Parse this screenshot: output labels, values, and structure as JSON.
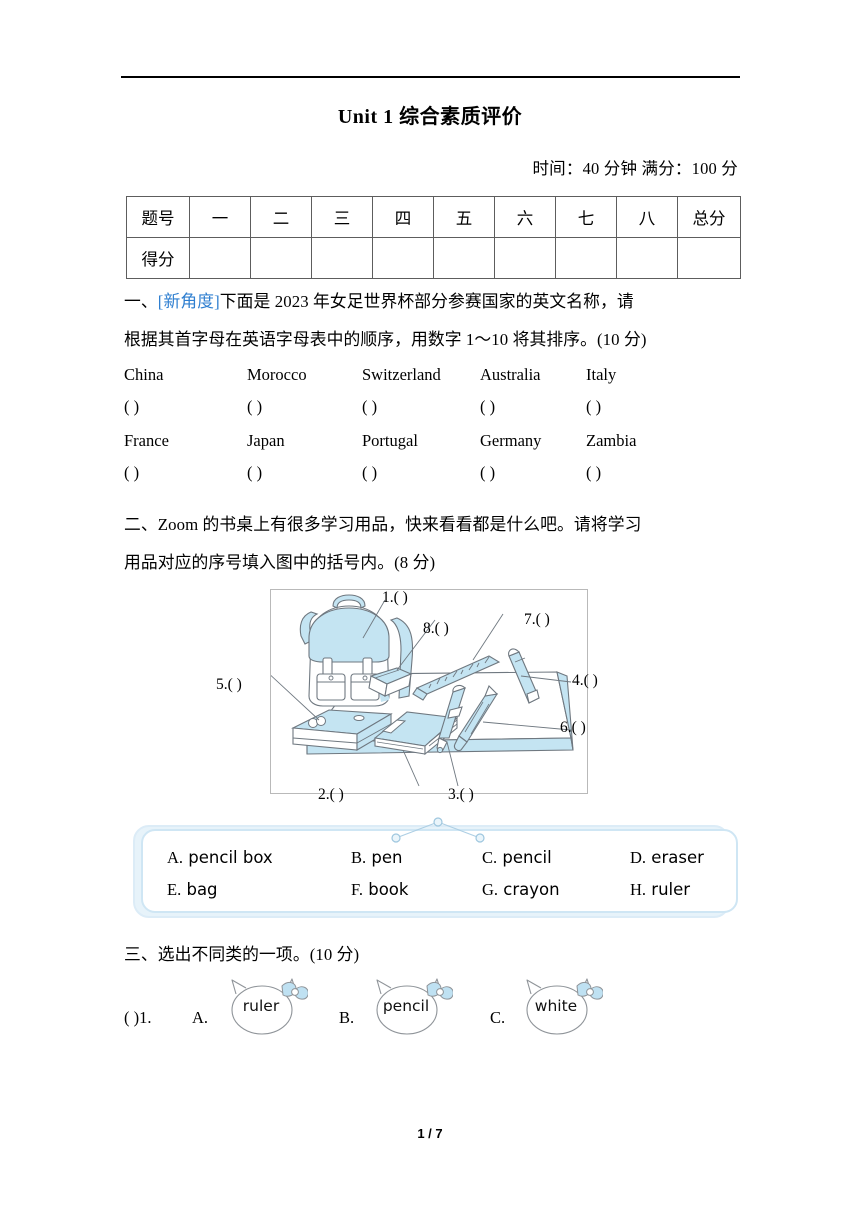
{
  "document": {
    "title": "Unit 1  综合素质评价",
    "time_score_line": "时间：40 分钟  满分：100 分",
    "page_number": "1 / 7"
  },
  "score_table": {
    "row_labels": [
      "题号",
      "得分"
    ],
    "columns": [
      "一",
      "二",
      "三",
      "四",
      "五",
      "六",
      "七",
      "八",
      "总分"
    ],
    "score_values": [
      "",
      "",
      "",
      "",
      "",
      "",
      "",
      "",
      ""
    ]
  },
  "questions": [
    {
      "number": "一、",
      "tag": "[新角度]",
      "line1": "下面是 2023 年女足世界杯部分参赛国家的英文名称，请",
      "line2": "根据其首字母在英语字母表中的顺序，用数字 1～10 将其排序。(10 分)",
      "countries_row1": [
        "China",
        "Morocco",
        "Switzerland",
        "Australia",
        "Italy"
      ],
      "countries_row2": [
        "France",
        "Japan",
        "Portugal",
        "Germany",
        "Zambia"
      ],
      "blank_mark": "(        )"
    },
    {
      "number": "二、",
      "line1": "Zoom 的书桌上有很多学习用品，快来看看都是什么吧。请将学习",
      "line2": "用品对应的序号填入图中的括号内。(8 分)",
      "picture_labels": [
        {
          "id": "1",
          "text": "1.(          )"
        },
        {
          "id": "2",
          "text": "2.(        )"
        },
        {
          "id": "3",
          "text": "3.(        )"
        },
        {
          "id": "4",
          "text": "4.(         )"
        },
        {
          "id": "5",
          "text": "5.(        )"
        },
        {
          "id": "6",
          "text": "6.(        )"
        },
        {
          "id": "7",
          "text": "7.(         )"
        },
        {
          "id": "8",
          "text": "8.(          )"
        }
      ],
      "picture_items": [
        "bag",
        "pencil-box",
        "book",
        "pen",
        "pencil",
        "crayon",
        "ruler",
        "eraser"
      ],
      "options": [
        {
          "letter": "A.",
          "word": "pencil box"
        },
        {
          "letter": "B.",
          "word": "pen"
        },
        {
          "letter": "C.",
          "word": "pencil"
        },
        {
          "letter": "D.",
          "word": "eraser"
        },
        {
          "letter": "E.",
          "word": "bag"
        },
        {
          "letter": "F.",
          "word": "book"
        },
        {
          "letter": "G.",
          "word": "crayon"
        },
        {
          "letter": "H.",
          "word": "ruler"
        }
      ]
    },
    {
      "number": "三、",
      "line1": "选出不同类的一项。(10 分)",
      "item_number": "(        )1.",
      "choices": [
        {
          "letter": "A.",
          "word": "ruler"
        },
        {
          "letter": "B.",
          "word": "pencil"
        },
        {
          "letter": "C.",
          "word": "white"
        }
      ]
    }
  ],
  "colors": {
    "accent_blue": "#2f7fd0",
    "illustration_fill": "#c4e4f2",
    "illustration_stroke": "#8a8f96",
    "option_box_bg": "#e7f3fa",
    "bow_blue": "#bfe1f2"
  }
}
